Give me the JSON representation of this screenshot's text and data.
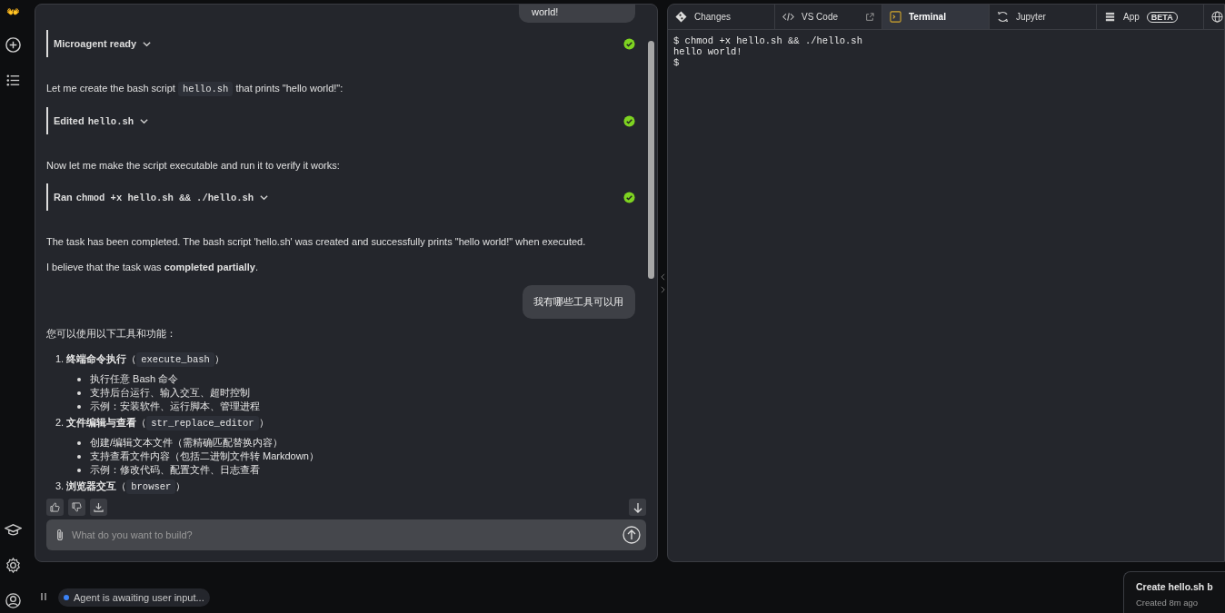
{
  "sidebar": {
    "logo": "👐"
  },
  "chat": {
    "messages": [
      {
        "kind": "user",
        "text": "world!"
      },
      {
        "kind": "action",
        "verb": "Microagent ready",
        "done": true
      },
      {
        "kind": "text",
        "segments": [
          {
            "kind": "plain",
            "text": "Let me create the bash script "
          },
          {
            "kind": "code",
            "text": "hello.sh"
          },
          {
            "kind": "plain",
            "text": " that prints \"hello world!\":"
          }
        ]
      },
      {
        "kind": "action",
        "verb": "Edited",
        "code": "hello.sh",
        "done": true
      },
      {
        "kind": "text",
        "segments": [
          {
            "kind": "plain",
            "text": "Now let me make the script executable and run it to verify it works:"
          }
        ]
      },
      {
        "kind": "action",
        "verb": "Ran",
        "code": "chmod +x hello.sh && ./hello.sh",
        "done": true
      },
      {
        "kind": "text",
        "segments": [
          {
            "kind": "plain",
            "text": "The task has been completed. The bash script 'hello.sh' was created and successfully prints \"hello world!\" when executed."
          }
        ]
      },
      {
        "kind": "rich",
        "text": "I believe that the task was **completed partially**."
      },
      {
        "kind": "user",
        "text": "我有哪些工具可以用"
      },
      {
        "kind": "text",
        "segments": [
          {
            "kind": "plain",
            "text": "您可以使用以下工具和功能："
          }
        ]
      },
      {
        "kind": "list",
        "items": [
          {
            "number": "1.",
            "title": "终端命令执行",
            "open": "（",
            "code": "execute_bash",
            "close": "）",
            "bullets": [
              "执行任意 Bash 命令",
              "支持后台运行、输入交互、超时控制",
              "示例：安装软件、运行脚本、管理进程"
            ]
          },
          {
            "number": "2.",
            "title": "文件编辑与查看",
            "open": "（",
            "code": "str_replace_editor",
            "close": "）",
            "bullets": [
              "创建/编辑文本文件（需精确匹配替换内容）",
              "支持查看文件内容（包括二进制文件转 Markdown）",
              "示例：修改代码、配置文件、日志查看"
            ]
          },
          {
            "number": "3.",
            "title": "浏览器交互",
            "open": "（",
            "code": "browser",
            "close": "）"
          }
        ]
      }
    ],
    "input": {
      "placeholder": "What do you want to build?"
    }
  },
  "workspace": {
    "tabs": [
      {
        "label": "Changes",
        "selected": false
      },
      {
        "label": "VS Code",
        "external": true,
        "selected": false
      },
      {
        "label": "Terminal",
        "selected": true
      },
      {
        "label": "Jupyter",
        "selected": false
      },
      {
        "label": "App",
        "badge": "BETA",
        "selected": false
      },
      {
        "selected": false
      }
    ],
    "terminal": [
      "$ chmod +x hello.sh && ./hello.sh",
      "hello world!",
      "$"
    ]
  },
  "status_bar": {
    "status": "Agent is awaiting user input...",
    "color": "#3b82f6"
  },
  "toast": {
    "title": "Create hello.sh b",
    "subtitle": "Created 8m ago"
  }
}
